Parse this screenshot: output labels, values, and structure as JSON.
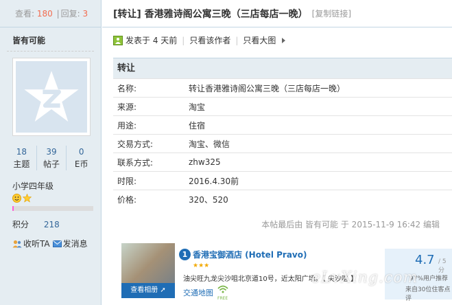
{
  "stats": {
    "views_label": "查看:",
    "views": "180",
    "sep": "|",
    "replies_label": "回复:",
    "replies": "3"
  },
  "author": {
    "name": "皆有可能",
    "counts": [
      {
        "value": "18",
        "label": "主题"
      },
      {
        "value": "39",
        "label": "帖子"
      },
      {
        "value": "0",
        "label": "E币"
      }
    ],
    "level": "小学四年级",
    "progress": 0.02,
    "points_label": "积分",
    "points": "218",
    "follow": "收听TA",
    "message": "发消息"
  },
  "thread": {
    "title": "[转让] 香港雅诗阁公寓三晚（三店每店一晚）",
    "copy_link": "[复制链接]",
    "posted": "发表于 4 天前",
    "only_author": "只看该作者",
    "big_image": "只看大图"
  },
  "info": {
    "heading": "转让",
    "rows": [
      {
        "k": "名称:",
        "v": "转让香港雅诗阁公寓三晚（三店每店一晚）"
      },
      {
        "k": "来源:",
        "v": "淘宝"
      },
      {
        "k": "用途:",
        "v": "住宿"
      },
      {
        "k": "交易方式:",
        "v": "淘宝、微信"
      },
      {
        "k": "联系方式:",
        "v": "zhw325"
      },
      {
        "k": "时限:",
        "v": "2016.4.30前"
      },
      {
        "k": "价格:",
        "v": "320、520"
      }
    ]
  },
  "edited": "本帖最后由 皆有可能 于 2015-11-9 16:42 编辑",
  "ad": {
    "num": "1",
    "name": "香港宝御酒店 (Hotel Pravo)",
    "stars": "★★★",
    "addr": "油尖旺九龙尖沙咀北京道10号，近太阳广场。【 尖沙咀 】",
    "photo_btn": "查看相册 ➚",
    "map": "交通地图",
    "free": "FREE",
    "score": "4.7",
    "score_max": "/ 5分",
    "pct": "97%用户推荐",
    "cnt": "来自30位住客点评"
  },
  "watermark": "eLvXing.com",
  "colors": {
    "accent": "#1f6db5",
    "num": "#f26c4f",
    "sidebar_bg": "#e5edf2"
  }
}
